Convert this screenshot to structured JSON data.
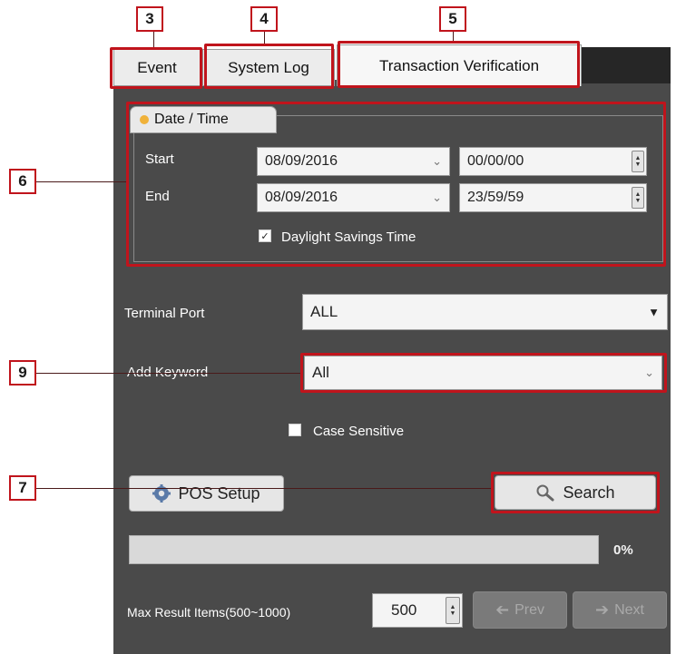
{
  "callouts": {
    "c3": "3",
    "c4": "4",
    "c5": "5",
    "c6": "6",
    "c7": "7",
    "c9": "9"
  },
  "tabs": {
    "event": "Event",
    "system_log": "System Log",
    "transaction_verification": "Transaction Verification"
  },
  "date_time": {
    "group_label": "Date / Time",
    "start_label": "Start",
    "start_date": "08/09/2016",
    "start_time": "00/00/00",
    "end_label": "End",
    "end_date": "08/09/2016",
    "end_time": "23/59/59",
    "daylight_label": "Daylight Savings Time",
    "daylight_checked": true
  },
  "terminal_port": {
    "label": "Terminal Port",
    "value": "ALL"
  },
  "keyword": {
    "label": "Add Keyword",
    "value": "All"
  },
  "case_sensitive": {
    "label": "Case Sensitive",
    "checked": false
  },
  "buttons": {
    "pos_setup": "POS Setup",
    "search": "Search",
    "prev": "Prev",
    "next": "Next"
  },
  "progress": {
    "percent_label": "0%",
    "value": 0
  },
  "max_results": {
    "label": "Max Result Items(500~1000)",
    "value": "500"
  },
  "icons": [
    "check-icon",
    "chevron-down-icon",
    "spin-arrows-icon",
    "gear-icon",
    "magnifier-icon",
    "arrow-left-icon",
    "arrow-right-icon"
  ]
}
